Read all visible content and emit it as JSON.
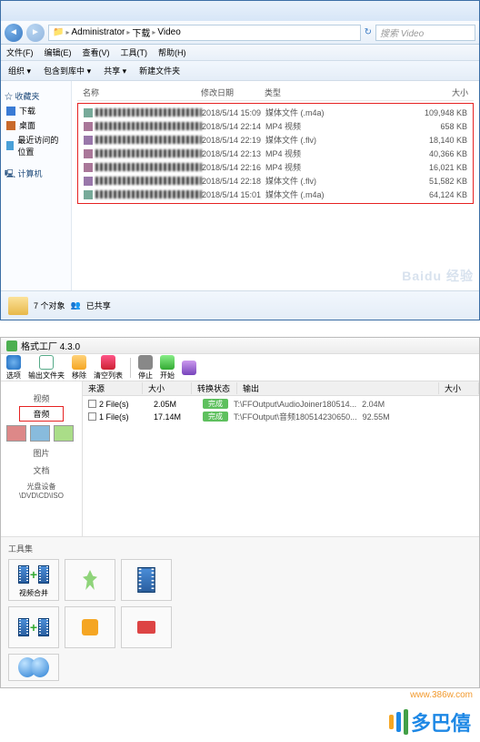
{
  "explorer": {
    "breadcrumb": [
      "Administrator",
      "下载",
      "Video"
    ],
    "search_placeholder": "搜索 Video",
    "menu": [
      "文件(F)",
      "编辑(E)",
      "查看(V)",
      "工具(T)",
      "帮助(H)"
    ],
    "toolbar": [
      "组织",
      "包含到库中",
      "共享",
      "新建文件夹"
    ],
    "sidebar": {
      "favorites": "收藏夹",
      "items": [
        {
          "label": "下载",
          "color": "#3a7bd5"
        },
        {
          "label": "桌面",
          "color": "#c96a2b"
        },
        {
          "label": "最近访问的位置",
          "color": "#49a0d8"
        }
      ],
      "computer": "计算机"
    },
    "columns": [
      "名称",
      "修改日期",
      "类型",
      "大小"
    ],
    "files": [
      {
        "date": "2018/5/14 15:09",
        "type": "媒体文件 (.m4a)",
        "size": "109,948 KB"
      },
      {
        "date": "2018/5/14 22:14",
        "type": "MP4 视频",
        "size": "658 KB"
      },
      {
        "date": "2018/5/14 22:19",
        "type": "媒体文件 (.flv)",
        "size": "18,140 KB"
      },
      {
        "date": "2018/5/14 22:13",
        "type": "MP4 视频",
        "size": "40,366 KB"
      },
      {
        "date": "2018/5/14 22:16",
        "type": "MP4 视频",
        "size": "16,021 KB"
      },
      {
        "date": "2018/5/14 22:18",
        "type": "媒体文件 (.flv)",
        "size": "51,582 KB"
      },
      {
        "date": "2018/5/14 15:01",
        "type": "媒体文件 (.m4a)",
        "size": "64,124 KB"
      }
    ],
    "status": {
      "count": "7 个对象",
      "state": "已共享"
    },
    "watermark": "Baidu 经验"
  },
  "ff": {
    "title": "格式工厂 4.3.0",
    "toolbar": [
      {
        "label": "选项"
      },
      {
        "label": "输出文件夹"
      },
      {
        "label": "移除"
      },
      {
        "label": "清空列表"
      },
      {
        "label": "停止"
      },
      {
        "label": "开始"
      },
      {
        "label": ""
      }
    ],
    "columns": [
      "来源",
      "大小",
      "转换状态",
      "输出",
      "大小"
    ],
    "side": {
      "cat1": "视频",
      "cat1_sel": "音频",
      "cat2": "图片",
      "cat3": "文档",
      "rom": "光盘设备\\DVD\\CD\\ISO",
      "tools": "工具集"
    },
    "rows": [
      {
        "name": "2 File(s)",
        "size": "2.05M",
        "status": "完成",
        "out": "T:\\FFOutput\\AudioJoiner180514...",
        "osize": "2.04M"
      },
      {
        "name": "1 File(s)",
        "size": "17.14M",
        "status": "完成",
        "out": "T:\\FFOutput\\音频180514230650...",
        "osize": "92.55M"
      }
    ],
    "tools": [
      "视频合并",
      "",
      "",
      "",
      "",
      ""
    ],
    "url": "www.386w.com"
  },
  "brand": {
    "text": "多巴僖",
    "colors": [
      "#f5a623",
      "#1e88e5",
      "#43a047"
    ]
  }
}
